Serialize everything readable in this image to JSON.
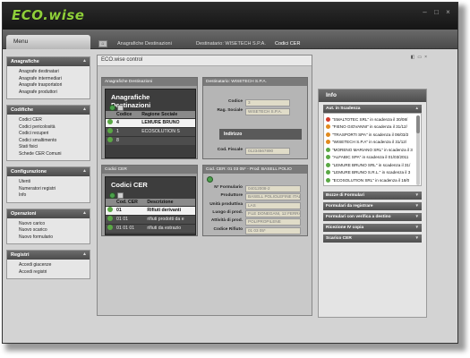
{
  "app": {
    "logo": "ECO.wise"
  },
  "window_controls": [
    {
      "name": "minimize-button",
      "glyph": "–"
    },
    {
      "name": "maximize-button",
      "glyph": "□"
    },
    {
      "name": "close-button",
      "glyph": "×"
    }
  ],
  "tabs": {
    "menu": "Menu",
    "documents": [
      "Anagrafiche Destinazioni",
      "Destinatario: WISETECH S.P.A.",
      "Codici CER"
    ]
  },
  "sidebar": {
    "groups": [
      {
        "title": "Anagrafiche",
        "items": [
          "Anagrafe destinatari",
          "Anagrafe intermediari",
          "Anagrafe trasportatori",
          "Anagrafe produttori"
        ]
      },
      {
        "title": "Codifiche",
        "items": [
          "Codici CER",
          "Codici pericolosità",
          "Codici recuperi",
          "Codici smaltimento",
          "Stati fisici",
          "Schede CER Comuni"
        ]
      },
      {
        "title": "Configurazione",
        "items": [
          "Utenti",
          "Numeratori registri",
          "Info"
        ]
      },
      {
        "title": "Operazioni",
        "items": [
          "Nuovo carico",
          "Nuovo scarico",
          "Nuovo formulario"
        ]
      },
      {
        "title": "Registri",
        "items": [
          "Accedi giacenze",
          "Accedi registri"
        ]
      }
    ]
  },
  "main": {
    "title": "ECO.wise control",
    "panel_dest": {
      "header": "Anagrafiche Destinazioni",
      "title": "Anagrafiche Destinazioni",
      "columns": [
        "Codice",
        "Ragione Sociale"
      ],
      "rows": [
        {
          "code": "4",
          "name": "LEMURE BRUNO",
          "selected": true
        },
        {
          "code": "1",
          "name": "ECOSOLUTION S",
          "selected": false
        },
        {
          "code": "8",
          "name": "",
          "selected": false
        }
      ]
    },
    "panel_destinatario": {
      "header": "Destinatario: WISETECH S.P.A.",
      "fields": [
        {
          "label": "Codice",
          "value": "3"
        },
        {
          "label": "Rag. Sociale",
          "value": "WISETECH S.P.A."
        }
      ],
      "section": "Indirizzo",
      "fiscal_label": "Cod. Fiscale",
      "fiscal_value": "01234567890"
    },
    "panel_cer": {
      "header": "Codici CER",
      "title": "Codici CER",
      "columns": [
        "Cod. CER",
        "Descrizione"
      ],
      "rows": [
        {
          "code": "01",
          "desc": "Rifiuti derivanti",
          "selected": true
        },
        {
          "code": "01 01",
          "desc": "rifiuti prodotti da e",
          "selected": false
        },
        {
          "code": "01 01 01",
          "desc": "rifiuti da estrazio",
          "selected": false
        }
      ]
    },
    "panel_form": {
      "header": "Cod. CER: 01 03 05* - Prod: BASELL POLIO",
      "fields": [
        {
          "label": "N° Formulario",
          "value": "04012008-2"
        },
        {
          "label": "Produttore",
          "value": "BASELL POLIOLEFINE ITALIA"
        },
        {
          "label": "Unità produttiva",
          "value": "LAS"
        },
        {
          "label": "Luogo di prod.",
          "value": "P.LE DONEGANI, 12 FERRARA"
        },
        {
          "label": "Attività di prod.",
          "value": "POLIPROPILENE"
        },
        {
          "label": "Codice Rifiuto",
          "value": "01 03 05*"
        }
      ]
    }
  },
  "info": {
    "title": "Info",
    "scadenze_title": "Aut. in Scadenza",
    "scadenze": [
      {
        "text": "\"SMALTOTEC SRL\" in scadenza il 30/08/",
        "color": "#d23b2b"
      },
      {
        "text": "\"FIENO GIOVANNI\" in scadenza il 31/12/",
        "color": "#e08a1e"
      },
      {
        "text": "\"TRASPORTI SPA\" in scadenza il 06/03/2",
        "color": "#e08a1e"
      },
      {
        "text": "\"WISETECH S.P.A\" in scadenza il 31/12/",
        "color": "#e08a1e"
      },
      {
        "text": "\"MORENO MARIANO SRL\" in scadenza il 3",
        "color": "#5aa845"
      },
      {
        "text": "\"ALFABIC SPA\" in scadenza il 01/03/2011",
        "color": "#5aa845"
      },
      {
        "text": "\"LEMURE BRUNO SRL\" in scadenza il 31/",
        "color": "#5aa845"
      },
      {
        "text": "\"LEMURE BRUNO S.R.L.\" in scadenza il 3",
        "color": "#5aa845"
      },
      {
        "text": "\"ECOSOLUTION SRL\" in scadenza il 18/0",
        "color": "#5aa845"
      }
    ],
    "sections": [
      "Bozze di Formulari",
      "Formulari da registrare",
      "Formulari con verifica a destino",
      "Ricezione IV copia",
      "Scarico CER"
    ]
  }
}
